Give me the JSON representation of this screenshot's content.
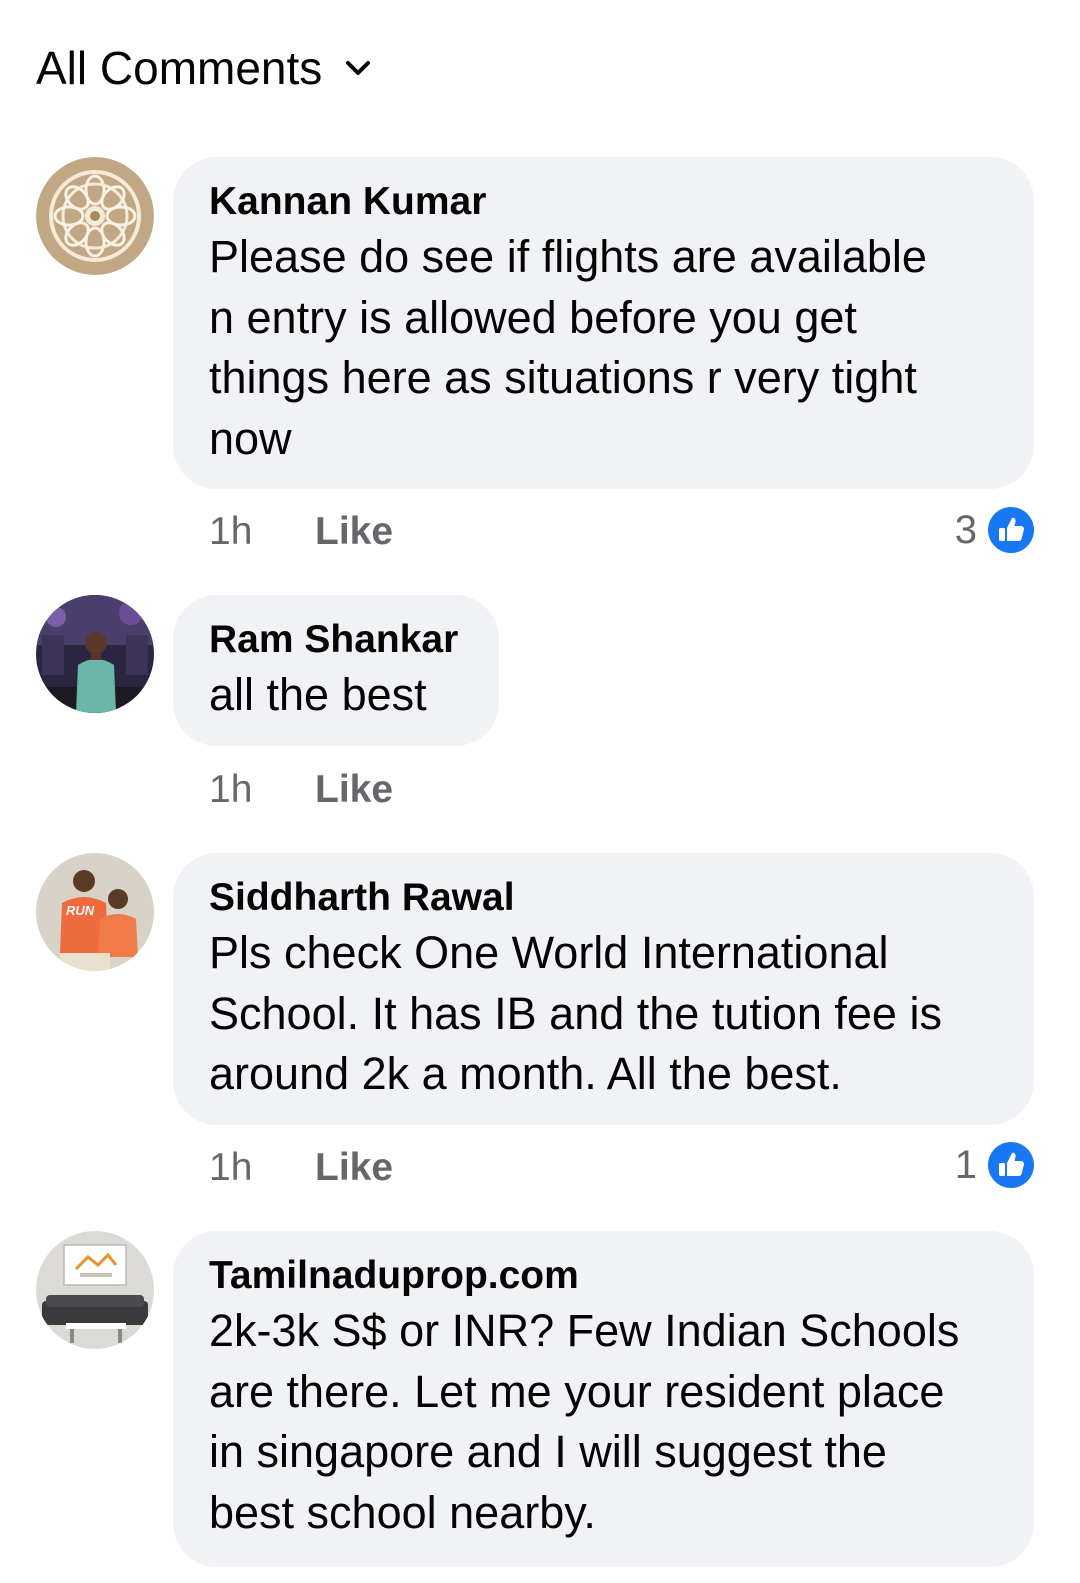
{
  "header": {
    "filter_label": "All Comments"
  },
  "colors": {
    "bubble": "#f0f2f5",
    "meta_text": "#65676b",
    "like_blue": "#1877f2"
  },
  "comments": [
    {
      "author": "Kannan Kumar",
      "text": "Please do see if flights are available\nn entry is allowed before you get\nthings here as situations r very tight\nnow",
      "time": "1h",
      "like_label": "Like",
      "reaction_count": "3",
      "reaction_icon": "thumbs-up-icon",
      "avatar": "mandala-pattern-avatar"
    },
    {
      "author": "Ram Shankar",
      "text": "all the best",
      "time": "1h",
      "like_label": "Like",
      "avatar": "person-photo-avatar"
    },
    {
      "author": "Siddharth Rawal",
      "text": "Pls check One World International\nSchool. It has IB and the tution fee is\naround 2k a month. All the best.",
      "time": "1h",
      "like_label": "Like",
      "reaction_count": "1",
      "reaction_icon": "thumbs-up-icon",
      "avatar": "run-shirts-avatar"
    },
    {
      "author": "Tamilnaduprop.com",
      "text": "2k-3k S$ or INR? Few Indian Schools\nare there. Let me your resident place\nin singapore and I will suggest the\nbest school nearby.",
      "avatar": "property-logo-avatar"
    }
  ]
}
